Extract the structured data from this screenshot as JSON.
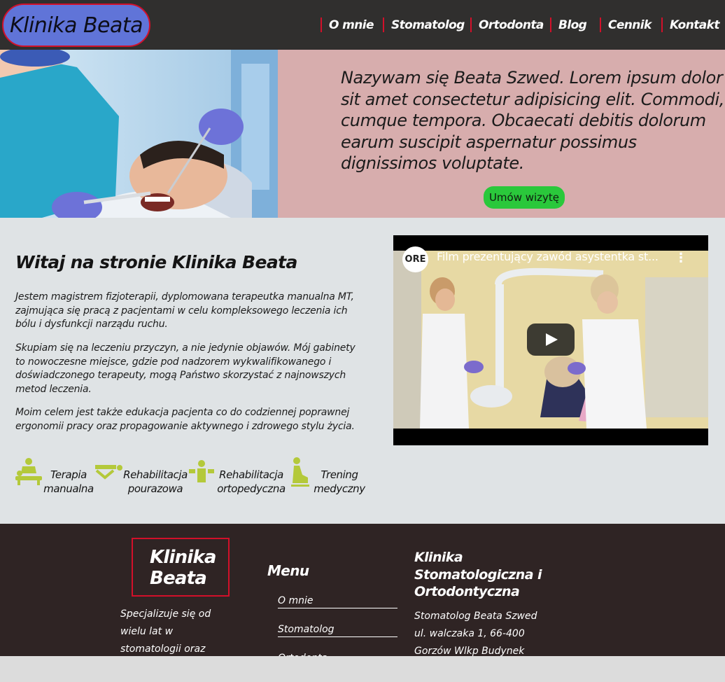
{
  "header": {
    "logo": "Klinika Beata",
    "nav": [
      "O mnie",
      "Stomatolog",
      "Ortodonta",
      "Blog",
      "Cennik",
      "Kontakt"
    ]
  },
  "hero": {
    "text": "Nazywam się Beata Szwed. Lorem ipsum dolor sit amet consectetur adipisicing elit. Commodi, cumque tempora. Obcaecati debitis dolorum earum suscipit aspernatur possimus dignissimos voluptate.",
    "cta": "Umów wizytę"
  },
  "main": {
    "title": "Witaj na stronie Klinika Beata",
    "paragraphs": [
      "Jestem magistrem fizjoterapii, dyplomowana terapeutka manualna MT, zajmująca się pracą z pacjentami w celu kompleksowego leczenia ich bólu i dysfunkcji narządu ruchu.",
      "Skupiam się na leczeniu przyczyn, a nie jedynie objawów. Mój gabinety to nowoczesne miejsce, gdzie pod nadzorem wykwalifikowanego i doświadczonego terapeuty, mogą Państwo skorzystać z najnowszych metod leczenia.",
      "Moim celem jest także edukacja pacjenta co do codziennej poprawnej ergonomii pracy oraz propagowanie aktywnego i zdrowego stylu życia."
    ],
    "services": [
      {
        "line1": "Terapia",
        "line2": "manualna",
        "icon": "massage-icon"
      },
      {
        "line1": "Rehabilitacja",
        "line2": "pourazowa",
        "icon": "rehab-bed-icon"
      },
      {
        "line1": "Rehabilitacja",
        "line2": "ortopedyczna",
        "icon": "orthopedic-icon"
      },
      {
        "line1": "Trening",
        "line2": "medyczny",
        "icon": "training-icon"
      }
    ]
  },
  "video": {
    "channel_logo": "ORE",
    "title": "Film prezentujący zawód asystentka st...",
    "menu": "⋮"
  },
  "footer": {
    "logo": "Klinika Beata",
    "description": "Specjalizuje się od wielu lat w stomatologii oraz ortodontii. Pomogłam już",
    "menu_title": "Menu",
    "menu": [
      "O mnie",
      "Stomatolog",
      "Ortodonta"
    ],
    "contact_title": "Klinika Stomatologiczna i Ortodontyczna",
    "contact_lines": [
      "Stomatolog Beata Szwed",
      "ul. walczaka 1, 66-400",
      "Gorzów Wlkp Budynek"
    ]
  },
  "colors": {
    "header_bg": "#302f2e",
    "logo_bg": "#6074d8",
    "accent_red": "#d2102a",
    "hero_panel": "#d7adad",
    "cta_green": "#2ac83b",
    "icon_green": "#b4c93a",
    "footer_bg": "#2f2424"
  }
}
